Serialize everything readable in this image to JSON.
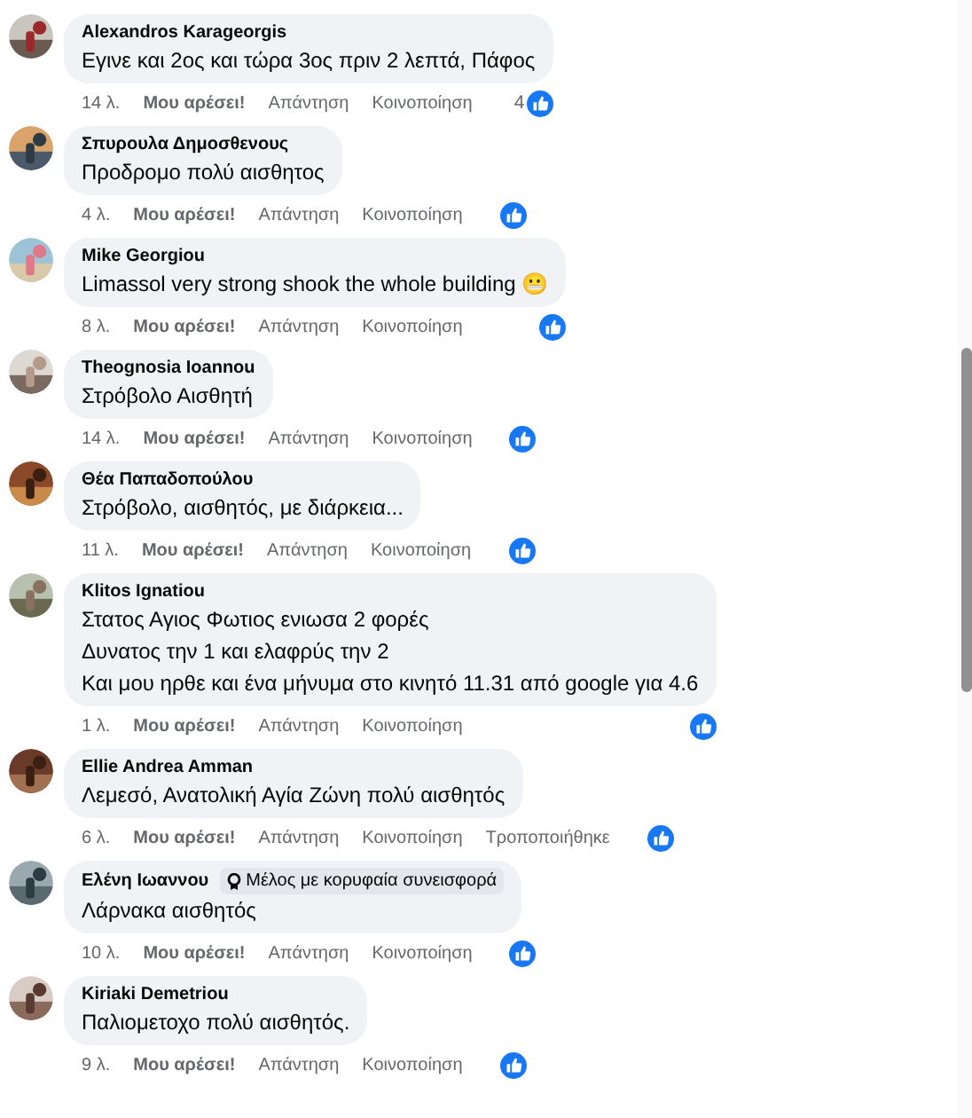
{
  "comments": [
    {
      "author": "Alexandros Karageorgis",
      "lines": [
        "Εγινε και 2ος και τώρα 3ος πριν 2 λεπτά, Πάφος"
      ],
      "time": "14 λ.",
      "like": "Μου αρέσει!",
      "reply": "Απάντηση",
      "share": "Κοινοποίηση",
      "like_count": "4"
    },
    {
      "author": "Σπυρουλα Δημοσθενους",
      "lines": [
        "Προδρομο πολύ αισθητος"
      ],
      "time": "4 λ.",
      "like": "Μου αρέσει!",
      "reply": "Απάντηση",
      "share": "Κοινοποίηση"
    },
    {
      "author": "Mike Georgiou",
      "lines": [
        "Limassol very strong shook the whole building 😬"
      ],
      "time": "8 λ.",
      "like": "Μου αρέσει!",
      "reply": "Απάντηση",
      "share": "Κοινοποίηση"
    },
    {
      "author": "Theognosia Ioannou",
      "lines": [
        "Στρόβολο Αισθητή"
      ],
      "time": "14 λ.",
      "like": "Μου αρέσει!",
      "reply": "Απάντηση",
      "share": "Κοινοποίηση"
    },
    {
      "author": "Θέα Παπαδοπούλου",
      "lines": [
        "Στρόβολο, αισθητός, με διάρκεια..."
      ],
      "time": "11 λ.",
      "like": "Μου αρέσει!",
      "reply": "Απάντηση",
      "share": "Κοινοποίηση"
    },
    {
      "author": "Klitos Ignatiou",
      "lines": [
        "Στατος Αγιος Φωτιος ενιωσα 2 φορές",
        "Δυνατος την 1 και ελαφρύς την 2",
        "Και μου ηρθε και ένα μήνυμα στο κινητό 11.31 από google για 4.6"
      ],
      "time": "1 λ.",
      "like": "Μου αρέσει!",
      "reply": "Απάντηση",
      "share": "Κοινοποίηση"
    },
    {
      "author": "Ellie Andrea Amman",
      "lines": [
        "Λεμεσό, Ανατολική Αγία Ζώνη πολύ αισθητός"
      ],
      "time": "6 λ.",
      "like": "Μου αρέσει!",
      "reply": "Απάντηση",
      "share": "Κοινοποίηση",
      "edited": "Τροποποιήθηκε"
    },
    {
      "author": "Ελένη Ιωαννου",
      "badge": "Μέλος με κορυφαία συνεισφορά",
      "lines": [
        "Λάρνακα αισθητός"
      ],
      "time": "10 λ.",
      "like": "Μου αρέσει!",
      "reply": "Απάντηση",
      "share": "Κοινοποίηση"
    },
    {
      "author": "Kiriaki Demetriou",
      "lines": [
        "Παλιομετοχο πολύ αισθητός."
      ],
      "time": "9 λ.",
      "like": "Μου αρέσει!",
      "reply": "Απάντηση",
      "share": "Κοινοποίηση"
    }
  ]
}
